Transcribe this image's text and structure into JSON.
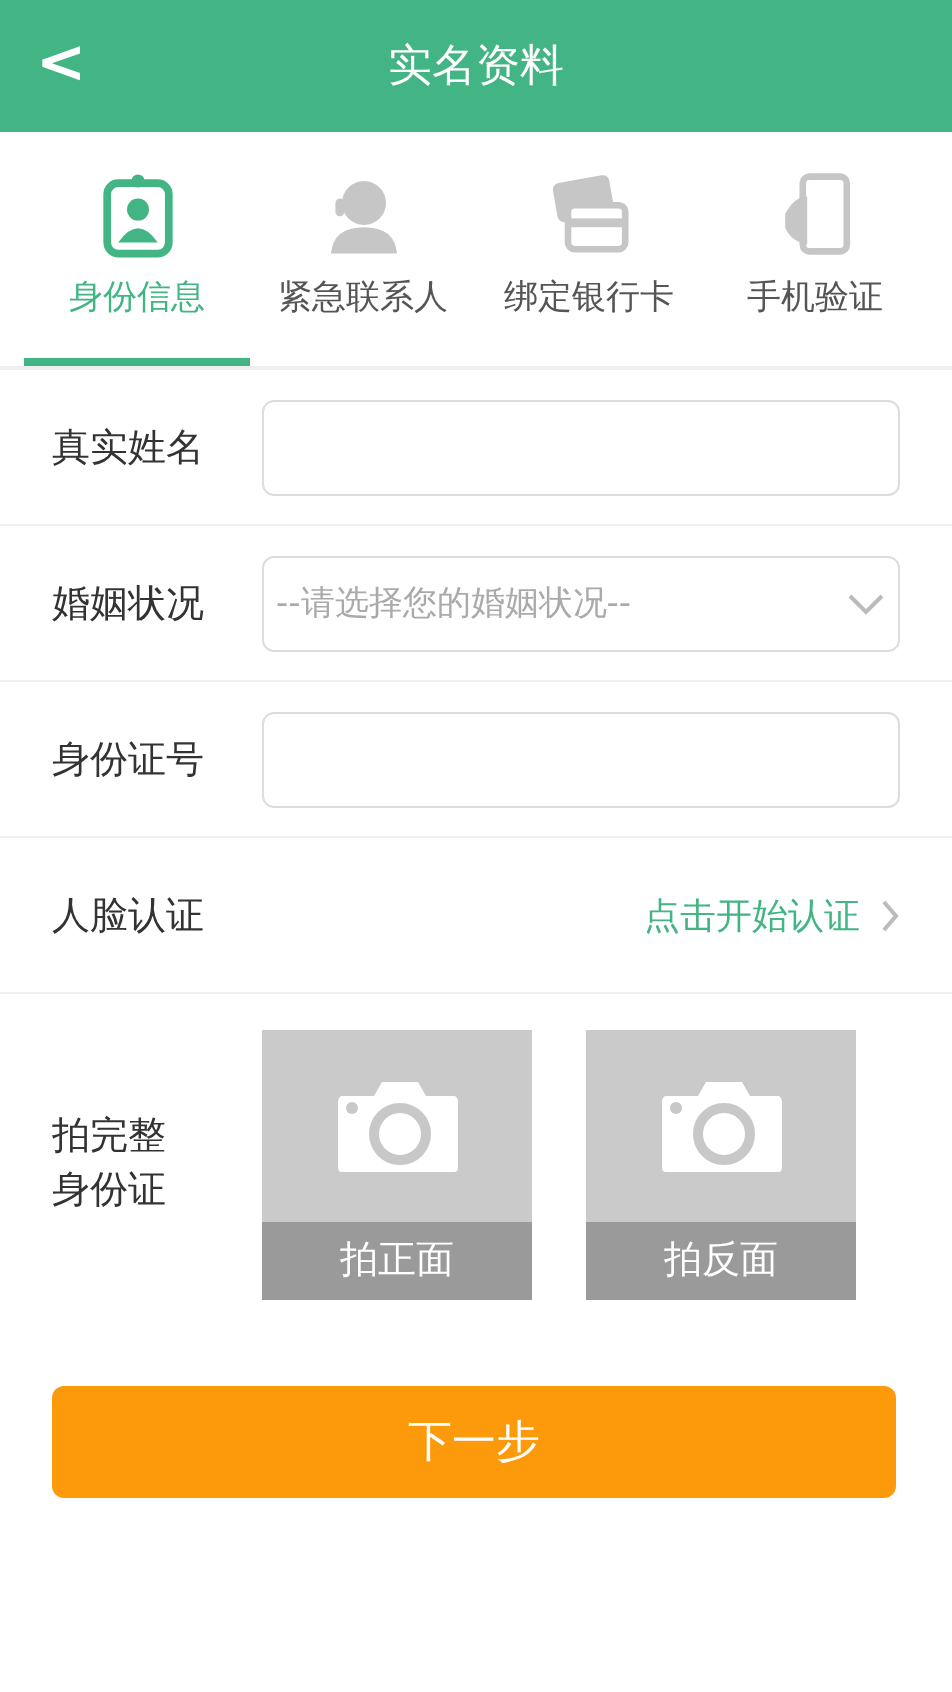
{
  "header": {
    "back": "<",
    "title": "实名资料"
  },
  "tabs": [
    {
      "label": "身份信息",
      "selected": true,
      "kind": "badge"
    },
    {
      "label": "紧急联系人",
      "selected": false,
      "kind": "agent"
    },
    {
      "label": "绑定银行卡",
      "selected": false,
      "kind": "card"
    },
    {
      "label": "手机验证",
      "selected": false,
      "kind": "phone"
    }
  ],
  "form": [
    {
      "kind": "input",
      "label": "真实姓名"
    },
    {
      "kind": "select",
      "label": "婚姻状况",
      "placeholder": "--请选择您的婚姻状况--"
    },
    {
      "kind": "input",
      "label": "身份证号"
    },
    {
      "kind": "link",
      "label": "人脸认证",
      "action": "点击开始认证"
    }
  ],
  "photos": {
    "label": "拍完整身份证",
    "items": [
      "拍正面",
      "拍反面"
    ]
  },
  "next_button": "下一步"
}
